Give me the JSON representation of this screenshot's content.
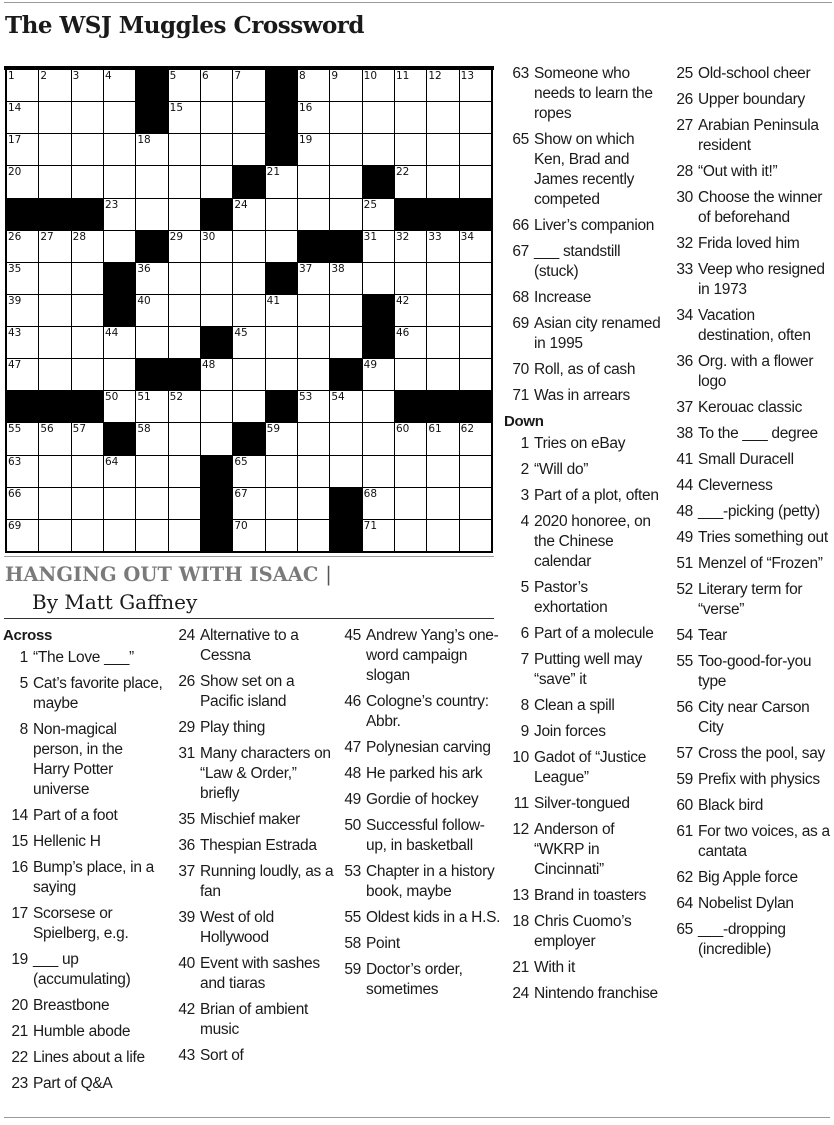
{
  "header": {
    "title": "The WSJ Muggles Crossword"
  },
  "puzzle": {
    "theme": "HANGING OUT WITH ISAAC",
    "separator": "|",
    "byline": "By Matt Gaffney",
    "grid": [
      "1,2,3,4,#,5,6,7,#,8,9,10,11,12,13",
      "14,.,.,.,#,15,.,.,#,16,.,.,.,.,.",
      "17,.,.,.,18,.,.,.,#,19,.,.,.,.,.",
      "20,.,.,.,.,.,.,#,21,.,.,#,22,.,.",
      "#,#,#,23,.,.,#,24,.,.,.,25,#,#,#",
      "26,27,28,.,#,29,30,.,.,#,#,31,32,33,34",
      "35,.,.,#,36,.,.,.,#,37,38,.,.,.,.",
      "39,.,.,#,40,.,.,.,41,.,.,#,42,.,.",
      "43,.,.,44,.,.,#,45,.,.,.,#,46,.,.",
      "47,.,.,.,#,#,48,.,.,.,#,49,.,.,.",
      "#,#,#,50,51,52,.,.,#,53,54,.,#,#,#",
      "55,56,57,#,58,.,.,#,59,.,.,.,60,61,62",
      "63,.,.,64,.,.,#,65,.,.,.,.,.,.,.",
      "66,.,.,.,.,.,#,67,.,.,#,68,.,.,.",
      "69,.,.,.,.,.,#,70,.,.,#,71,.,.,."
    ]
  },
  "across_label": "Across",
  "down_label": "Down",
  "columns": [
    {
      "heading": "Across",
      "clues": [
        {
          "n": "1",
          "t": "“The Love ___”"
        },
        {
          "n": "5",
          "t": "Cat’s favorite place, maybe"
        },
        {
          "n": "8",
          "t": "Non-magical person, in the Harry Potter universe"
        },
        {
          "n": "14",
          "t": "Part of a foot"
        },
        {
          "n": "15",
          "t": "Hellenic H"
        },
        {
          "n": "16",
          "t": "Bump’s place, in a saying"
        },
        {
          "n": "17",
          "t": "Scorsese or Spielberg, e.g."
        },
        {
          "n": "19",
          "t": "___ up (accumulating)"
        },
        {
          "n": "20",
          "t": "Breastbone"
        },
        {
          "n": "21",
          "t": "Humble abode"
        },
        {
          "n": "22",
          "t": "Lines about a life"
        },
        {
          "n": "23",
          "t": "Part of Q&A"
        }
      ]
    },
    {
      "heading": "",
      "clues": [
        {
          "n": "24",
          "t": "Alternative to a Cessna"
        },
        {
          "n": "26",
          "t": "Show set on a Pacific island"
        },
        {
          "n": "29",
          "t": "Play thing"
        },
        {
          "n": "31",
          "t": "Many characters on “Law & Order,” briefly"
        },
        {
          "n": "35",
          "t": "Mischief maker"
        },
        {
          "n": "36",
          "t": "Thespian Estrada"
        },
        {
          "n": "37",
          "t": "Running loudly, as a fan"
        },
        {
          "n": "39",
          "t": "West of old Hollywood"
        },
        {
          "n": "40",
          "t": "Event with sashes and tiaras"
        },
        {
          "n": "42",
          "t": "Brian of ambient music"
        },
        {
          "n": "43",
          "t": "Sort of"
        }
      ]
    },
    {
      "heading": "",
      "clues": [
        {
          "n": "45",
          "t": "Andrew Yang’s one-word campaign slogan"
        },
        {
          "n": "46",
          "t": "Cologne’s country: Abbr."
        },
        {
          "n": "47",
          "t": "Polynesian carving"
        },
        {
          "n": "48",
          "t": "He parked his ark"
        },
        {
          "n": "49",
          "t": "Gordie of hockey"
        },
        {
          "n": "50",
          "t": "Successful follow-up, in basketball"
        },
        {
          "n": "53",
          "t": "Chapter in a history book, maybe"
        },
        {
          "n": "55",
          "t": "Oldest kids in a H.S."
        },
        {
          "n": "58",
          "t": "Point"
        },
        {
          "n": "59",
          "t": "Doctor’s order, sometimes"
        }
      ]
    },
    {
      "heading": "",
      "clues": [
        {
          "n": "63",
          "t": "Someone who needs to learn the ropes"
        },
        {
          "n": "65",
          "t": "Show on which Ken, Brad and James recently competed"
        },
        {
          "n": "66",
          "t": "Liver’s companion"
        },
        {
          "n": "67",
          "t": "___ standstill (stuck)"
        },
        {
          "n": "68",
          "t": "Increase"
        },
        {
          "n": "69",
          "t": "Asian city renamed in 1995"
        },
        {
          "n": "70",
          "t": "Roll, as of cash"
        },
        {
          "n": "71",
          "t": "Was in arrears"
        }
      ],
      "subheading": "Down",
      "subclues": [
        {
          "n": "1",
          "t": "Tries on eBay"
        },
        {
          "n": "2",
          "t": "“Will do”"
        },
        {
          "n": "3",
          "t": "Part of a plot, often"
        },
        {
          "n": "4",
          "t": "2020 honoree, on the Chinese calendar"
        },
        {
          "n": "5",
          "t": "Pastor’s exhortation"
        },
        {
          "n": "6",
          "t": "Part of a molecule"
        },
        {
          "n": "7",
          "t": "Putting well may “save” it"
        },
        {
          "n": "8",
          "t": "Clean a spill"
        },
        {
          "n": "9",
          "t": "Join forces"
        },
        {
          "n": "10",
          "t": "Gadot of “Justice League”"
        },
        {
          "n": "11",
          "t": "Silver-tongued"
        },
        {
          "n": "12",
          "t": "Anderson of “WKRP in Cincinnati”"
        },
        {
          "n": "13",
          "t": "Brand in toasters"
        },
        {
          "n": "18",
          "t": "Chris Cuomo’s employer"
        },
        {
          "n": "21",
          "t": "With it"
        },
        {
          "n": "24",
          "t": "Nintendo franchise"
        }
      ]
    },
    {
      "heading": "",
      "clues": [
        {
          "n": "25",
          "t": "Old-school cheer"
        },
        {
          "n": "26",
          "t": "Upper boundary"
        },
        {
          "n": "27",
          "t": "Arabian Peninsula resident"
        },
        {
          "n": "28",
          "t": "“Out with it!”"
        },
        {
          "n": "30",
          "t": "Choose the winner of beforehand"
        },
        {
          "n": "32",
          "t": "Frida loved him"
        },
        {
          "n": "33",
          "t": "Veep who resigned in 1973"
        },
        {
          "n": "34",
          "t": "Vacation destination, often"
        },
        {
          "n": "36",
          "t": "Org. with a flower logo"
        },
        {
          "n": "37",
          "t": "Kerouac classic"
        },
        {
          "n": "38",
          "t": "To the ___ degree"
        },
        {
          "n": "41",
          "t": "Small Duracell"
        },
        {
          "n": "44",
          "t": "Cleverness"
        },
        {
          "n": "48",
          "t": "___-picking (petty)"
        },
        {
          "n": "49",
          "t": "Tries something out"
        },
        {
          "n": "51",
          "t": "Menzel of “Frozen”"
        },
        {
          "n": "52",
          "t": "Literary term for “verse”"
        },
        {
          "n": "54",
          "t": "Tear"
        },
        {
          "n": "55",
          "t": "Too-good-for-you type"
        },
        {
          "n": "56",
          "t": "City near Carson City"
        },
        {
          "n": "57",
          "t": "Cross the pool, say"
        },
        {
          "n": "59",
          "t": "Prefix with physics"
        },
        {
          "n": "60",
          "t": "Black bird"
        },
        {
          "n": "61",
          "t": "For two voices, as a cantata"
        },
        {
          "n": "62",
          "t": "Big Apple force"
        },
        {
          "n": "64",
          "t": "Nobelist Dylan"
        },
        {
          "n": "65",
          "t": "___-dropping (incredible)"
        }
      ]
    }
  ]
}
